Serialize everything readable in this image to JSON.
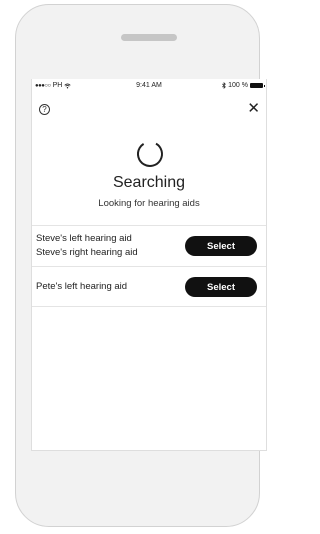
{
  "status_bar": {
    "carrier": "PH",
    "time": "9:41 AM",
    "battery": "100 %"
  },
  "icons": {
    "help": "?",
    "close": "✕"
  },
  "main": {
    "title": "Searching",
    "subtitle": "Looking for hearing aids"
  },
  "devices": [
    {
      "line1": "Steve's left hearing aid",
      "line2": "Steve's right hearing aid",
      "button": "Select"
    },
    {
      "line1": "Pete's left hearing aid",
      "button": "Select"
    }
  ]
}
